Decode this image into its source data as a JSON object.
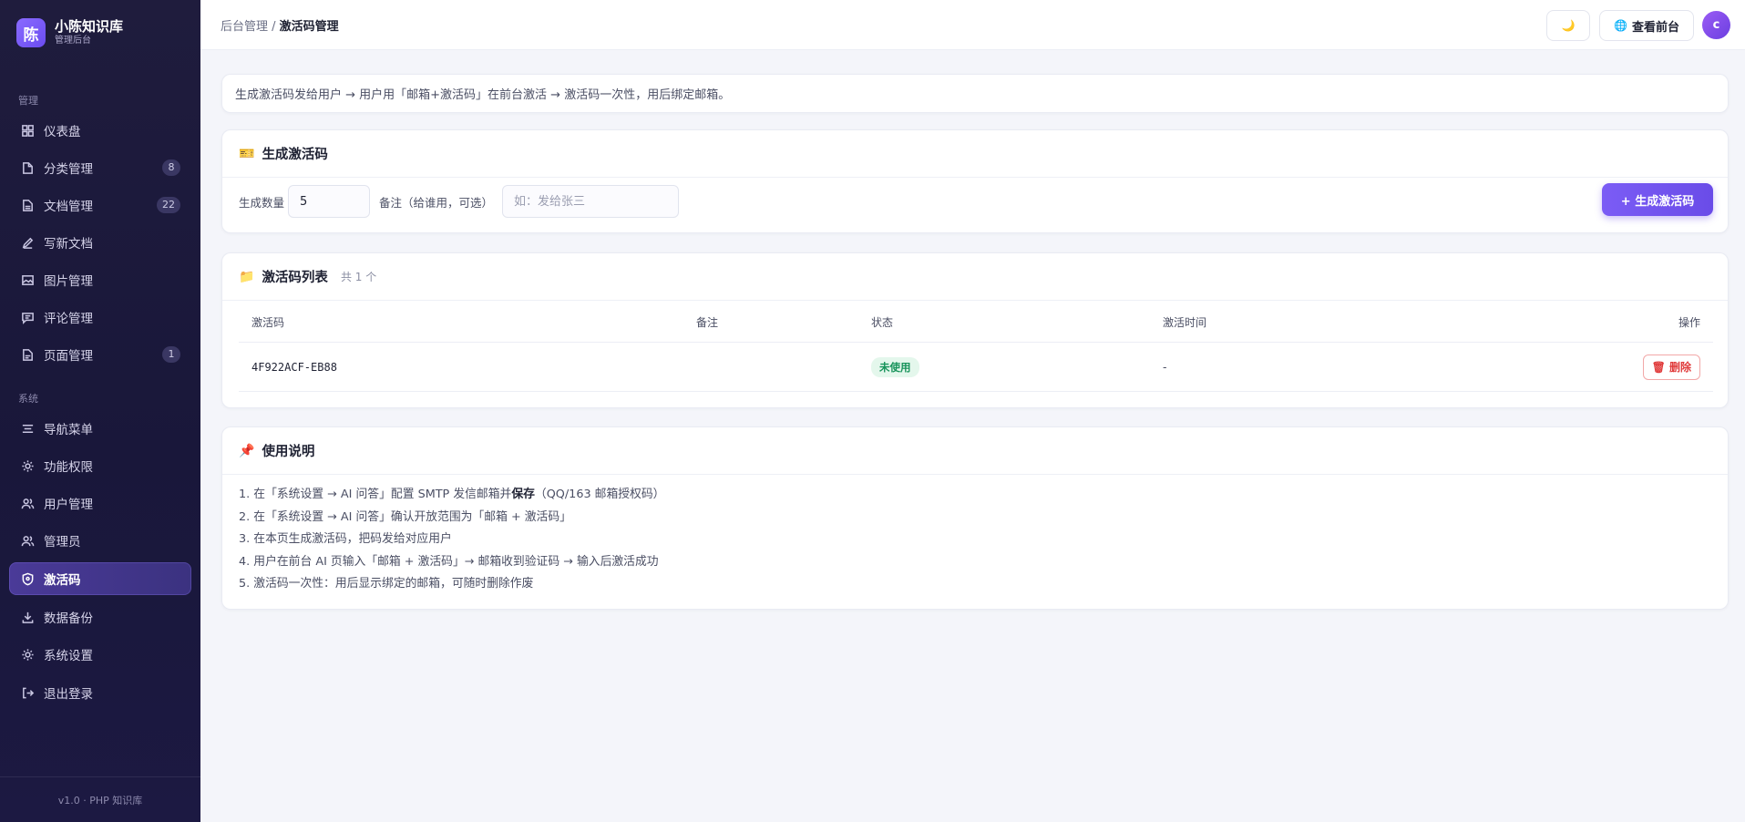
{
  "brand": {
    "logo_char": "陈",
    "name": "小陈知识库",
    "subtitle": "管理后台"
  },
  "sidebar": {
    "section_manage": "管理",
    "section_system": "系统",
    "items": [
      {
        "label": "仪表盘",
        "icon": "dashboard-icon"
      },
      {
        "label": "分类管理",
        "icon": "folder-icon",
        "badge": "8"
      },
      {
        "label": "文档管理",
        "icon": "document-icon",
        "badge": "22"
      },
      {
        "label": "写新文档",
        "icon": "pen-icon"
      },
      {
        "label": "图片管理",
        "icon": "image-icon"
      },
      {
        "label": "评论管理",
        "icon": "comment-icon"
      },
      {
        "label": "页面管理",
        "icon": "page-icon",
        "badge": "1"
      },
      {
        "label": "导航菜单",
        "icon": "menu-icon"
      },
      {
        "label": "功能权限",
        "icon": "settings-icon"
      },
      {
        "label": "用户管理",
        "icon": "users-icon"
      },
      {
        "label": "管理员",
        "icon": "admin-icon"
      },
      {
        "label": "激活码",
        "icon": "shield-icon",
        "active": true
      },
      {
        "label": "数据备份",
        "icon": "download-icon"
      },
      {
        "label": "系统设置",
        "icon": "gear-icon"
      },
      {
        "label": "退出登录",
        "icon": "logout-icon"
      }
    ],
    "footer": "v1.0 · PHP 知识库"
  },
  "topbar": {
    "breadcrumb_parent": "后台管理",
    "breadcrumb_sep": " / ",
    "breadcrumb_current": "激活码管理",
    "theme_icon": "🌙",
    "view_front_icon": "🌐",
    "view_front_label": "查看前台",
    "avatar_char": "c"
  },
  "info": {
    "text": "生成激活码发给用户 → 用户用「邮箱+激活码」在前台激活 → 激活码一次性，用后绑定邮箱。"
  },
  "generate": {
    "title_icon": "🎫",
    "title": "生成激活码",
    "qty_label": "生成数量",
    "qty_value": "5",
    "note_label": "备注（给谁用，可选）",
    "note_placeholder": "如：发给张三",
    "button_label": "+ 生成激活码"
  },
  "code_list": {
    "title_icon": "📁",
    "title": "激活码列表",
    "count": "共 1 个",
    "columns": [
      "激活码",
      "备注",
      "状态",
      "激活时间",
      "操作"
    ],
    "rows": [
      {
        "code": "4F922ACF-EB88",
        "note": "",
        "status": "未使用",
        "activated_at": "-",
        "action": "🗑 删除"
      }
    ]
  },
  "usage": {
    "title_icon": "📌",
    "title": "使用说明",
    "steps": [
      {
        "pre": "1. 在「系统设置 → AI 问答」配置 SMTP 发信邮箱并",
        "bold": "保存",
        "post": "（QQ/163 邮箱授权码）"
      },
      {
        "pre": "2. 在「系统设置 → AI 问答」确认开放范围为「邮箱 + 激活码」",
        "bold": "",
        "post": ""
      },
      {
        "pre": "3. 在本页生成激活码，把码发给对应用户",
        "bold": "",
        "post": ""
      },
      {
        "pre": "4. 用户在前台 AI 页输入「邮箱 + 激活码」→ 邮箱收到验证码 → 输入后激活成功",
        "bold": "",
        "post": ""
      },
      {
        "pre": "5. 激活码一次性：用后显示绑定的邮箱，可随时删除作废",
        "bold": "",
        "post": ""
      }
    ]
  },
  "colors": {
    "accent": "#6a4ce8",
    "sidebar_bg": "#1f1c3d",
    "status_unused": "#16935a",
    "danger": "#e03a3a"
  }
}
